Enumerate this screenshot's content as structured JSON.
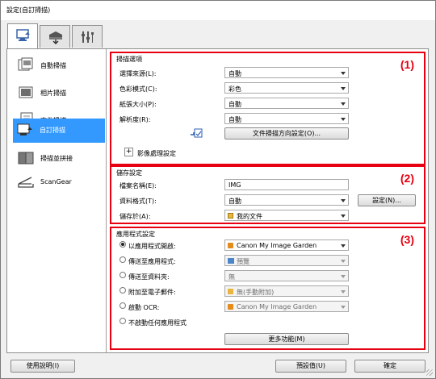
{
  "window": {
    "title": "設定(自訂掃描)"
  },
  "sidebar": {
    "items": [
      {
        "label": "自動掃描",
        "icon": "auto-scan-icon"
      },
      {
        "label": "相片掃描",
        "icon": "photo-scan-icon"
      },
      {
        "label": "文件掃描",
        "icon": "document-scan-icon"
      },
      {
        "label": "自訂掃描",
        "icon": "custom-scan-icon",
        "selected": true
      },
      {
        "label": "掃描並拼接",
        "icon": "scan-and-stitch-icon"
      },
      {
        "label": "ScanGear",
        "icon": "scangear-icon"
      }
    ]
  },
  "scan_options": {
    "title": "掃描選項",
    "number": "(1)",
    "source_label": "選擇來源(L):",
    "source_value": "自動",
    "color_label": "色彩模式(C):",
    "color_value": "彩色",
    "paper_label": "紙張大小(P):",
    "paper_value": "自動",
    "resolution_label": "解析度(R):",
    "resolution_value": "自動",
    "orientation_button": "文件掃描方向設定(O)...",
    "image_processing_label": "影像處理設定",
    "expand_symbol": "+"
  },
  "save_settings": {
    "title": "儲存設定",
    "number": "(2)",
    "filename_label": "檔案名稱(E):",
    "filename_value": "IMG",
    "format_label": "資料格式(T):",
    "format_value": "自動",
    "format_settings_button": "設定(N)...",
    "save_in_label": "儲存於(A):",
    "save_in_value": "我的文件"
  },
  "app_settings": {
    "title": "應用程式設定",
    "number": "(3)",
    "options": [
      {
        "label": "以應用程式開啟:",
        "value": "Canon My Image Garden",
        "selected": true,
        "enabled": true
      },
      {
        "label": "傳送至應用程式:",
        "value": "預覽",
        "selected": false,
        "enabled": false
      },
      {
        "label": "傳送至資料夾:",
        "value": "無",
        "selected": false,
        "enabled": false
      },
      {
        "label": "附加至電子郵件:",
        "value": "無(手動附加)",
        "selected": false,
        "enabled": false
      },
      {
        "label": "啟動 OCR:",
        "value": "Canon My Image Garden",
        "selected": false,
        "enabled": false
      },
      {
        "label": "不啟動任何應用程式",
        "selected": false
      }
    ],
    "more_functions_button": "更多功能(M)"
  },
  "footer": {
    "help_button": "使用說明(I)",
    "defaults_button": "預設值(U)",
    "ok_button": "確定"
  },
  "colors": {
    "highlight": "#e60012",
    "selection": "#3399ff"
  }
}
